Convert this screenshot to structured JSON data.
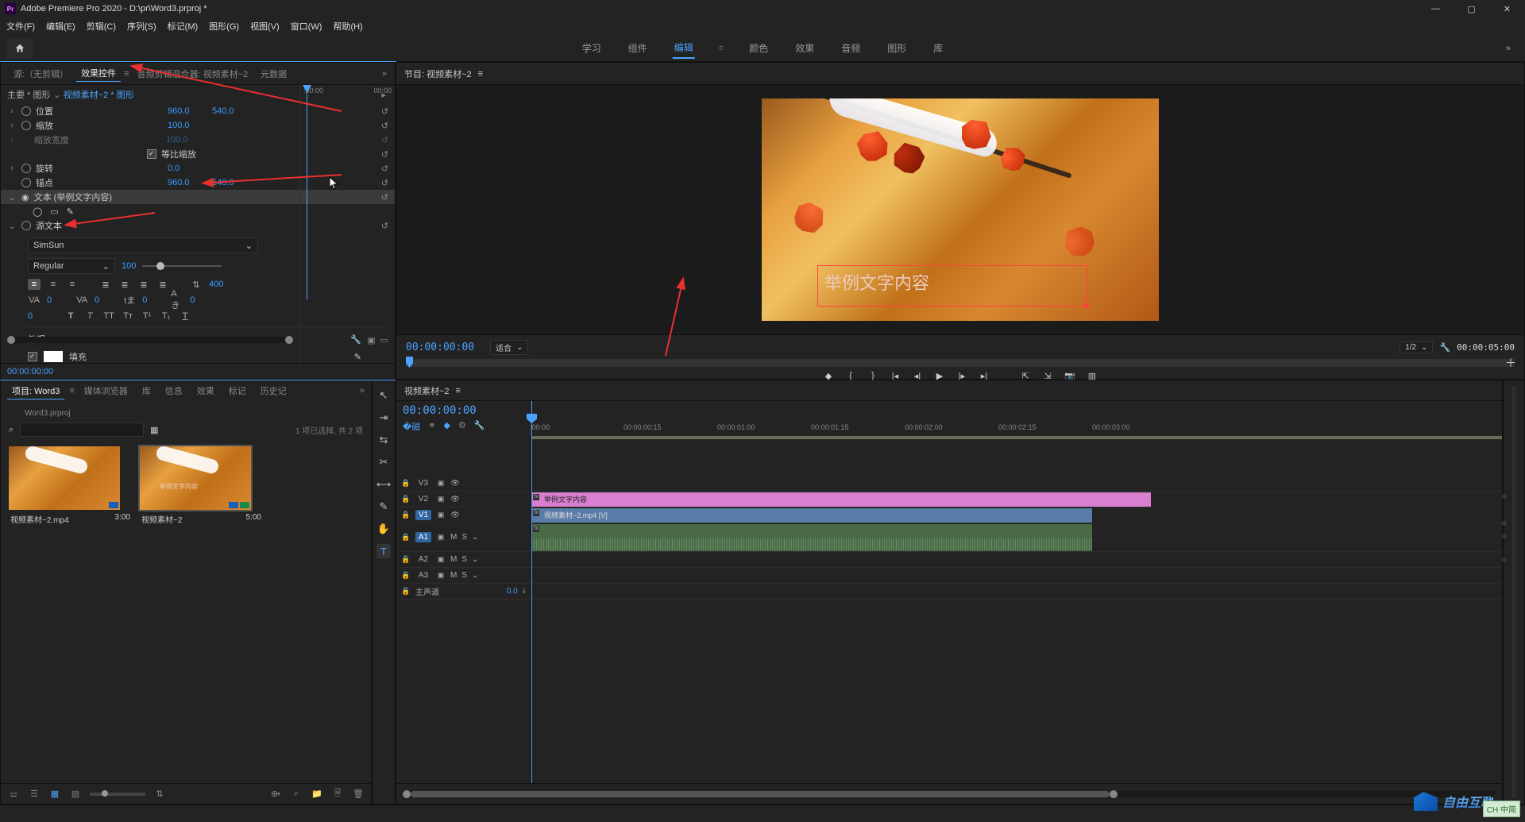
{
  "app": {
    "title": "Adobe Premiere Pro 2020 - D:\\pr\\Word3.prproj *",
    "logo": "Pr"
  },
  "menu": [
    "文件(F)",
    "编辑(E)",
    "剪辑(C)",
    "序列(S)",
    "标记(M)",
    "图形(G)",
    "视图(V)",
    "窗口(W)",
    "帮助(H)"
  ],
  "workspaces": {
    "items": [
      "学习",
      "组件",
      "编辑",
      "颜色",
      "效果",
      "音频",
      "图形",
      "库"
    ],
    "active": "编辑",
    "more": "»"
  },
  "panel_ec": {
    "tabs": {
      "source": "源:（无剪辑）",
      "effect": "效果控件",
      "audiomix": "音频剪辑混合器: 视频素材~2",
      "metadata": "元数据",
      "menu": "≡",
      "more": "»"
    },
    "header": {
      "main_pre": "主要 * 图形",
      "seq": "视频素材~2 * 图形"
    },
    "time_start": ":00:00",
    "time_end": "00:00",
    "props": {
      "position": {
        "label": "位置",
        "x": "960.0",
        "y": "540.0"
      },
      "scale": {
        "label": "缩放",
        "v": "100.0"
      },
      "scalew": {
        "label": "缩放宽度",
        "v": "100.0"
      },
      "uniform": {
        "label": "等比缩放",
        "checked": true
      },
      "rotation": {
        "label": "旋转",
        "v": "0.0"
      },
      "anchor": {
        "label": "锚点",
        "x": "960.0",
        "y": "540.0"
      },
      "textlayer": {
        "label": "文本 (举例文字内容)",
        "eye": "◉"
      },
      "sourcetext": {
        "label": "源文本"
      },
      "font": "SimSun",
      "weight": "Regular",
      "size": "100",
      "leading_icon": "≡",
      "leading": "400",
      "va": "VA",
      "va_val": "0",
      "va2": "VA",
      "va2_val": "0",
      "tsume": "tま",
      "tsume_val": "0",
      "baseline": "Aき",
      "baseline_val": "0",
      "zero": "0",
      "stylebtns": [
        "T",
        "T",
        "TT",
        "Tт",
        "T¹",
        "T₁",
        "T"
      ],
      "appearance": "外观",
      "fill": "填充"
    },
    "footer_tc": "00:00:00:00"
  },
  "program": {
    "tab": "节目: 视频素材~2",
    "menu": "≡",
    "overlay_text": "举例文字内容",
    "tc_left": "00:00:00:00",
    "fit": "适合",
    "zoom_levels": [
      "1/2"
    ],
    "zoom": "1/2",
    "tc_right": "00:00:05:00",
    "transport_icons": [
      "mark-in",
      "mark-out",
      "go-in",
      "go-out",
      "step-back",
      "play",
      "step-fwd",
      "go-end",
      "lift",
      "extract",
      "export-frame",
      "comparison"
    ]
  },
  "project": {
    "tabs": [
      "项目: Word3",
      "媒体浏览器",
      "库",
      "信息",
      "效果",
      "标记",
      "历史记"
    ],
    "more": "»",
    "menu": "≡",
    "filename": "Word3.prproj",
    "search_placeholder": "",
    "search_icon": "⌕",
    "filter_icon": "▦",
    "info": "1 项已选择, 共 2 项",
    "items": [
      {
        "name": "视频素材~2.mp4",
        "dur": "3:00",
        "type": "clip"
      },
      {
        "name": "视频素材~2",
        "dur": "5:00",
        "type": "sequence",
        "overlay": "举例文字内容"
      }
    ],
    "footer_icons": [
      "bin",
      "list",
      "icon",
      "free",
      "sort",
      "auto",
      "search",
      "new-bin",
      "new-item",
      "trash"
    ]
  },
  "tools": [
    "selection",
    "track-select",
    "ripple",
    "razor",
    "slip",
    "pen",
    "hand",
    "text"
  ],
  "timeline": {
    "tab": "视频素材~2",
    "menu": "≡",
    "tc": "00:00:00:00",
    "snap_icons": [
      "snap",
      "link",
      "marker",
      "settings",
      "wrench"
    ],
    "ruler": [
      ":00:00",
      "00:00:00:15",
      "00:00:01:00",
      "00:00:01:15",
      "00:00:02:00",
      "00:00:02:15",
      "00:00:03:00"
    ],
    "tracks": {
      "v3": {
        "name": "V3"
      },
      "v2": {
        "name": "V2"
      },
      "v1": {
        "name": "V1"
      },
      "a1": {
        "name": "A1",
        "m": "M",
        "s": "S"
      },
      "a2": {
        "name": "A2",
        "m": "M",
        "s": "S"
      },
      "a3": {
        "name": "A3",
        "m": "M",
        "s": "S"
      },
      "master": {
        "name": "主声道",
        "val": "0.0"
      }
    },
    "clips": {
      "gfx": "举例文字内容",
      "vid": "视频素材~2.mp4 [V]"
    }
  },
  "ime": "CH 中简",
  "watermark": "自由互联"
}
